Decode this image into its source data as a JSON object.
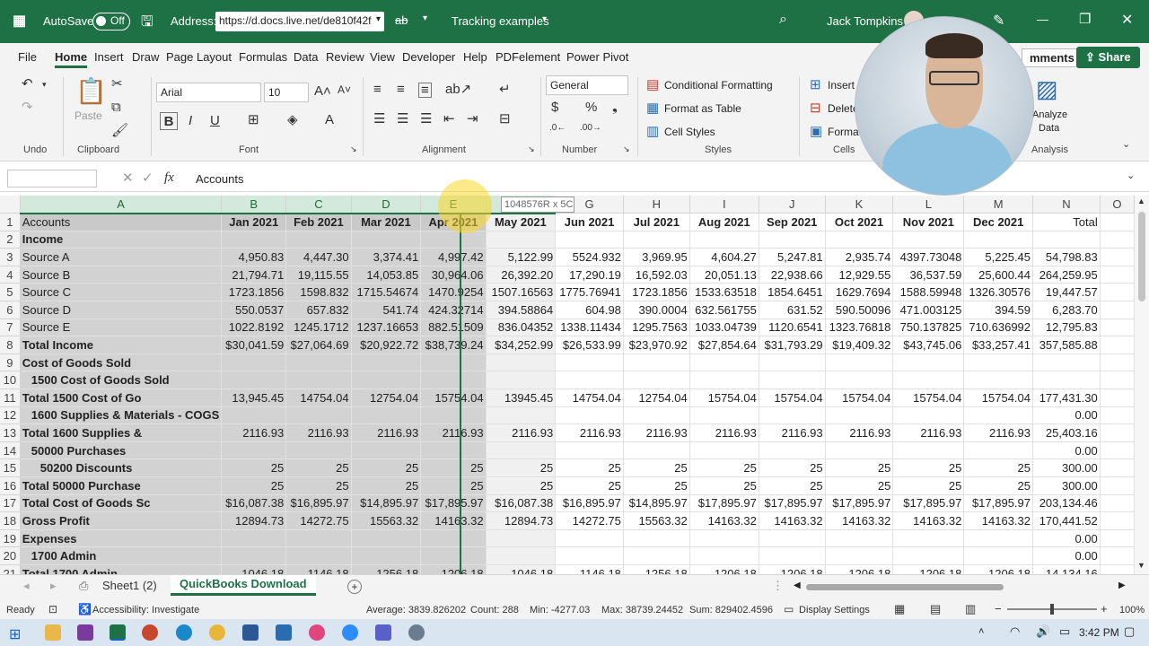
{
  "titlebar": {
    "autosave_label": "AutoSave",
    "autosave_state": "Off",
    "address_label": "Address:",
    "address_value": "https://d.docs.live.net/de810f42f",
    "doc_name": "Tracking examples",
    "user_name": "Jack Tompkins"
  },
  "menu": {
    "items": [
      "File",
      "Home",
      "Insert",
      "Draw",
      "Page Layout",
      "Formulas",
      "Data",
      "Review",
      "View",
      "Developer",
      "Help",
      "PDFelement",
      "Power Pivot"
    ],
    "comments_label": "mments",
    "share_label": "Share"
  },
  "ribbon": {
    "undo_label": "Undo",
    "paste_label": "Paste",
    "clipboard_label": "Clipboard",
    "font_name": "Arial",
    "font_size": "10",
    "font_label": "Font",
    "alignment_label": "Alignment",
    "number_format": "General",
    "number_label": "Number",
    "conditional_formatting": "Conditional Formatting",
    "format_as_table": "Format as Table",
    "cell_styles": "Cell Styles",
    "styles_label": "Styles",
    "insert": "Insert",
    "delete": "Delete",
    "format": "Format",
    "cells_label": "Cells",
    "analyze_line1": "Analyze",
    "analyze_line2": "Data",
    "analysis_label": "Analysis"
  },
  "formula_bar": {
    "fx": "fx",
    "content": "Accounts"
  },
  "tooltip": "1048576R x 5C",
  "columns": [
    "A",
    "B",
    "C",
    "D",
    "E",
    "F",
    "G",
    "H",
    "I",
    "J",
    "K",
    "L",
    "M",
    "N",
    "O"
  ],
  "rows": [
    {
      "n": "1",
      "cells": [
        "Accounts",
        "Jan 2021",
        "Feb 2021",
        "Mar 2021",
        "Apr 2021",
        "May 2021",
        "Jun 2021",
        "Jul 2021",
        "Aug 2021",
        "Sep 2021",
        "Oct 2021",
        "Nov 2021",
        "Dec 2021",
        "Total",
        ""
      ]
    },
    {
      "n": "2",
      "cells": [
        "Income",
        "",
        "",
        "",
        "",
        "",
        "",
        "",
        "",
        "",
        "",
        "",
        "",
        "",
        ""
      ]
    },
    {
      "n": "3",
      "cells": [
        "Source A",
        "4,950.83",
        "4,447.30",
        "3,374.41",
        "4,997.42",
        "5,122.99",
        "5524.932",
        "3,969.95",
        "4,604.27",
        "5,247.81",
        "2,935.74",
        "4397.73048",
        "5,225.45",
        "54,798.83",
        ""
      ]
    },
    {
      "n": "4",
      "cells": [
        "Source B",
        "21,794.71",
        "19,115.55",
        "14,053.85",
        "30,964.06",
        "26,392.20",
        "17,290.19",
        "16,592.03",
        "20,051.13",
        "22,938.66",
        "12,929.55",
        "36,537.59",
        "25,600.44",
        "264,259.95",
        ""
      ]
    },
    {
      "n": "5",
      "cells": [
        "Source C",
        "1723.1856",
        "1598.832",
        "1715.54674",
        "1470.9254",
        "1507.16563",
        "1775.76941",
        "1723.1856",
        "1533.63518",
        "1854.6451",
        "1629.7694",
        "1588.59948",
        "1326.30576",
        "19,447.57",
        ""
      ]
    },
    {
      "n": "6",
      "cells": [
        "Source D",
        "550.0537",
        "657.832",
        "541.74",
        "424.32714",
        "394.58864",
        "604.98",
        "390.0004",
        "632.561755",
        "631.52",
        "590.50096",
        "471.003125",
        "394.59",
        "6,283.70",
        ""
      ]
    },
    {
      "n": "7",
      "cells": [
        "Source E",
        "1022.8192",
        "1245.1712",
        "1237.16653",
        "882.51509",
        "836.04352",
        "1338.11434",
        "1295.7563",
        "1033.04739",
        "1120.6541",
        "1323.76818",
        "750.137825",
        "710.636992",
        "12,795.83",
        ""
      ]
    },
    {
      "n": "8",
      "cells": [
        "Total Income",
        "$30,041.59",
        "$27,064.69",
        "$20,922.72",
        "$38,739.24",
        "$34,252.99",
        "$26,533.99",
        "$23,970.92",
        "$27,854.64",
        "$31,793.29",
        "$19,409.32",
        "$43,745.06",
        "$33,257.41",
        "357,585.88",
        ""
      ]
    },
    {
      "n": "9",
      "cells": [
        "Cost of Goods Sold",
        "",
        "",
        "",
        "",
        "",
        "",
        "",
        "",
        "",
        "",
        "",
        "",
        "",
        ""
      ]
    },
    {
      "n": "10",
      "cells": [
        "1500 Cost of Goods Sold",
        "",
        "",
        "",
        "",
        "",
        "",
        "",
        "",
        "",
        "",
        "",
        "",
        "",
        ""
      ]
    },
    {
      "n": "11",
      "cells": [
        "Total 1500 Cost of Go",
        "13,945.45",
        "14754.04",
        "12754.04",
        "15754.04",
        "13945.45",
        "14754.04",
        "12754.04",
        "15754.04",
        "15754.04",
        "15754.04",
        "15754.04",
        "15754.04",
        "177,431.30",
        ""
      ]
    },
    {
      "n": "12",
      "cells": [
        "1600 Supplies & Materials - COGS",
        "",
        "",
        "",
        "",
        "",
        "",
        "",
        "",
        "",
        "",
        "",
        "",
        "0.00",
        ""
      ]
    },
    {
      "n": "13",
      "cells": [
        "Total 1600 Supplies &",
        "2116.93",
        "2116.93",
        "2116.93",
        "2116.93",
        "2116.93",
        "2116.93",
        "2116.93",
        "2116.93",
        "2116.93",
        "2116.93",
        "2116.93",
        "2116.93",
        "25,403.16",
        ""
      ]
    },
    {
      "n": "14",
      "cells": [
        "50000 Purchases",
        "",
        "",
        "",
        "",
        "",
        "",
        "",
        "",
        "",
        "",
        "",
        "",
        "0.00",
        ""
      ]
    },
    {
      "n": "15",
      "cells": [
        "50200 Discounts",
        "25",
        "25",
        "25",
        "25",
        "25",
        "25",
        "25",
        "25",
        "25",
        "25",
        "25",
        "25",
        "300.00",
        ""
      ]
    },
    {
      "n": "16",
      "cells": [
        "Total 50000 Purchase",
        "25",
        "25",
        "25",
        "25",
        "25",
        "25",
        "25",
        "25",
        "25",
        "25",
        "25",
        "25",
        "300.00",
        ""
      ]
    },
    {
      "n": "17",
      "cells": [
        "Total Cost of Goods Sc",
        "$16,087.38",
        "$16,895.97",
        "$14,895.97",
        "$17,895.97",
        "$16,087.38",
        "$16,895.97",
        "$14,895.97",
        "$17,895.97",
        "$17,895.97",
        "$17,895.97",
        "$17,895.97",
        "$17,895.97",
        "203,134.46",
        ""
      ]
    },
    {
      "n": "18",
      "cells": [
        "Gross Profit",
        "12894.73",
        "14272.75",
        "15563.32",
        "14163.32",
        "12894.73",
        "14272.75",
        "15563.32",
        "14163.32",
        "14163.32",
        "14163.32",
        "14163.32",
        "14163.32",
        "170,441.52",
        ""
      ]
    },
    {
      "n": "19",
      "cells": [
        "Expenses",
        "",
        "",
        "",
        "",
        "",
        "",
        "",
        "",
        "",
        "",
        "",
        "",
        "0.00",
        ""
      ]
    },
    {
      "n": "20",
      "cells": [
        "1700 Admin",
        "",
        "",
        "",
        "",
        "",
        "",
        "",
        "",
        "",
        "",
        "",
        "",
        "0.00",
        ""
      ]
    },
    {
      "n": "21",
      "cells": [
        "Total 1700 Admin",
        "1046.18",
        "1146.18",
        "1256.18",
        "1206.18",
        "1046.18",
        "1146.18",
        "1256.18",
        "1206.18",
        "1206.18",
        "1206.18",
        "1206.18",
        "1206.18",
        "14,134.16",
        ""
      ]
    }
  ],
  "sheet_tabs": [
    "Sheet1 (2)",
    "QuickBooks Download"
  ],
  "status": {
    "ready": "Ready",
    "accessibility": "Accessibility: Investigate",
    "average": "Average: 3839.826202",
    "count": "Count: 288",
    "min": "Min: -4277.03",
    "max": "Max: 38739.24452",
    "sum": "Sum: 829402.4596",
    "display_settings": "Display Settings",
    "zoom": "100%"
  },
  "taskbar": {
    "time": "3:42 PM"
  },
  "colors": {
    "excel_green": "#1e7145",
    "selection_gray": "#d2d2d2"
  }
}
